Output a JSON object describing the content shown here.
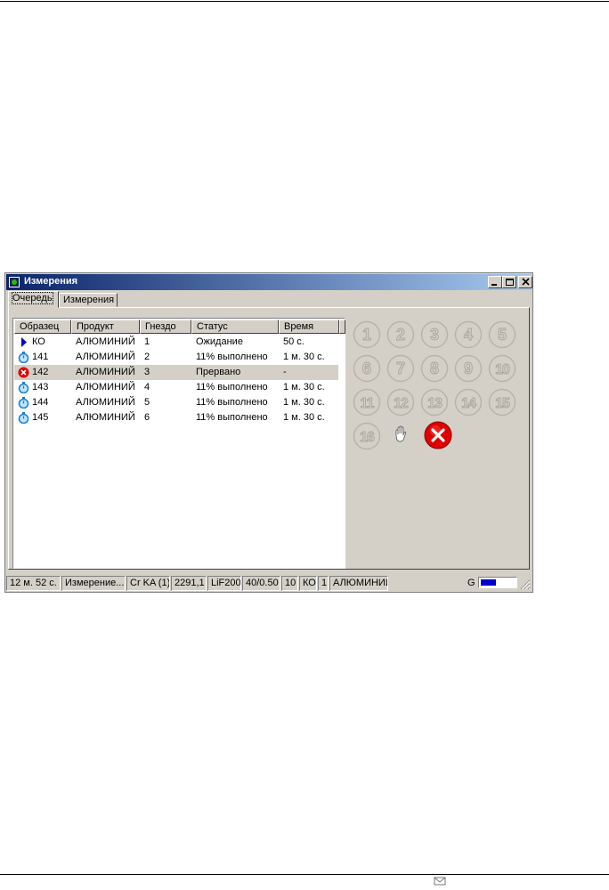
{
  "window": {
    "title": "Измерения"
  },
  "tabs": [
    {
      "label": "Очередь",
      "active": true
    },
    {
      "label": "Измерения",
      "active": false
    }
  ],
  "table": {
    "columns": [
      "Образец",
      "Продукт",
      "Гнездо",
      "Статус",
      "Время"
    ],
    "rows": [
      {
        "icon": "play-arrow-icon",
        "sample": "КО",
        "product": "АЛЮМИНИЙ",
        "slot": "1",
        "status": "Ожидание",
        "time": "50 с."
      },
      {
        "icon": "stopwatch-icon",
        "sample": "141",
        "product": "АЛЮМИНИЙ",
        "slot": "2",
        "status": "11% выполнено",
        "time": "1 м. 30 с."
      },
      {
        "icon": "error-icon",
        "sample": "142",
        "product": "АЛЮМИНИЙ",
        "slot": "3",
        "status": "Прервано",
        "time": "-",
        "selected": true
      },
      {
        "icon": "stopwatch-icon",
        "sample": "143",
        "product": "АЛЮМИНИЙ",
        "slot": "4",
        "status": "11% выполнено",
        "time": "1 м. 30 с."
      },
      {
        "icon": "stopwatch-icon",
        "sample": "144",
        "product": "АЛЮМИНИЙ",
        "slot": "5",
        "status": "11% выполнено",
        "time": "1 м. 30 с."
      },
      {
        "icon": "stopwatch-icon",
        "sample": "145",
        "product": "АЛЮМИНИЙ",
        "slot": "6",
        "status": "11% выполнено",
        "time": "1 м. 30 с."
      }
    ]
  },
  "slots": [
    "1",
    "2",
    "3",
    "4",
    "5",
    "6",
    "7",
    "8",
    "9",
    "10",
    "11",
    "12",
    "13",
    "14",
    "15",
    "16"
  ],
  "status_bar": {
    "elapsed": "12 м. 52 с.",
    "state": "Измерение...",
    "line": "Cr KA (1)",
    "angle": "2291,1",
    "crystal": "LiF200",
    "power": "40/0.50",
    "count": "10",
    "sample": "КО",
    "slot": "1",
    "product": "АЛЮМИНИЙ",
    "g_label": "G",
    "g_level": 0.45
  },
  "colors": {
    "title_start": "#0a246a",
    "title_end": "#a6caf0",
    "error_red": "#e00000",
    "stopwatch_blue": "#1a7fd0",
    "play_blue": "#0000d0",
    "g_fill": "#0000cc"
  }
}
